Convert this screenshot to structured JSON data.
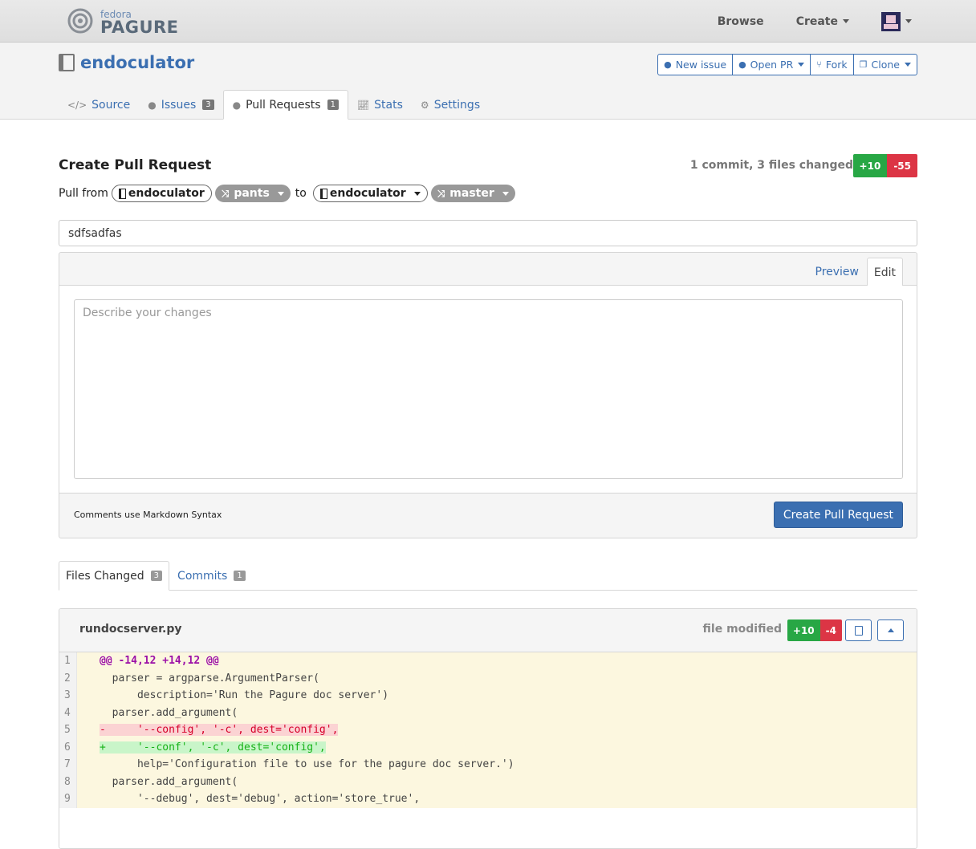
{
  "masthead": {
    "logo_small": "fedora",
    "logo_big": "PAGURE",
    "nav": [
      {
        "label": "Browse"
      },
      {
        "label": "Create"
      }
    ]
  },
  "repo": {
    "name": "endoculator",
    "buttons": [
      {
        "label": "New issue",
        "icon": "exclamation-circle-icon"
      },
      {
        "label": "Open PR",
        "icon": "arrow-circle-down-icon"
      },
      {
        "label": "Fork",
        "icon": "fork-icon"
      },
      {
        "label": "Clone",
        "icon": "copy-icon"
      }
    ],
    "tabs": [
      {
        "label": "Source",
        "icon": "code-icon"
      },
      {
        "label": "Issues",
        "icon": "exclamation-circle-icon",
        "count": "3"
      },
      {
        "label": "Pull Requests",
        "icon": "arrow-circle-down-icon",
        "count": "1"
      },
      {
        "label": "Stats",
        "icon": "line-chart-icon"
      },
      {
        "label": "Settings",
        "icon": "gears-icon"
      }
    ]
  },
  "pr": {
    "heading": "Create Pull Request",
    "summary": "1 commit, 3 files changed",
    "additions": "+10",
    "deletions": "-55",
    "pull_from_label": "Pull from",
    "from_repo": "endoculator",
    "from_branch": "pants",
    "to_label": "to",
    "to_repo": "endoculator",
    "to_branch": "master",
    "title_value": "sdfsadfas",
    "editor_tab_preview": "Preview",
    "editor_tab_edit": "Edit",
    "description_placeholder": "Describe your changes",
    "markdown_note": "Comments use Markdown Syntax",
    "submit_label": "Create Pull Request"
  },
  "files_tabs": [
    {
      "label": "Files Changed",
      "count": "3"
    },
    {
      "label": "Commits",
      "count": "1"
    }
  ],
  "file": {
    "name": "rundocserver.py",
    "status": "file modified",
    "additions": "+10",
    "deletions": "-4",
    "lines": [
      {
        "n": "1",
        "type": "hunk",
        "text": "@@ -14,12 +14,12 @@"
      },
      {
        "n": "2",
        "type": "ctx",
        "text": "  parser = argparse.ArgumentParser("
      },
      {
        "n": "3",
        "type": "ctx",
        "text": "      description='Run the Pagure doc server')"
      },
      {
        "n": "4",
        "type": "ctx",
        "text": "  parser.add_argument("
      },
      {
        "n": "5",
        "type": "del",
        "text": "-     '--config', '-c', dest='config',"
      },
      {
        "n": "6",
        "type": "add",
        "text": "+     '--conf', '-c', dest='config',"
      },
      {
        "n": "7",
        "type": "ctx",
        "text": "      help='Configuration file to use for the pagure doc server.')"
      },
      {
        "n": "8",
        "type": "ctx",
        "text": "  parser.add_argument("
      },
      {
        "n": "9",
        "type": "ctx",
        "text": "      '--debug', dest='debug', action='store_true',"
      }
    ]
  }
}
